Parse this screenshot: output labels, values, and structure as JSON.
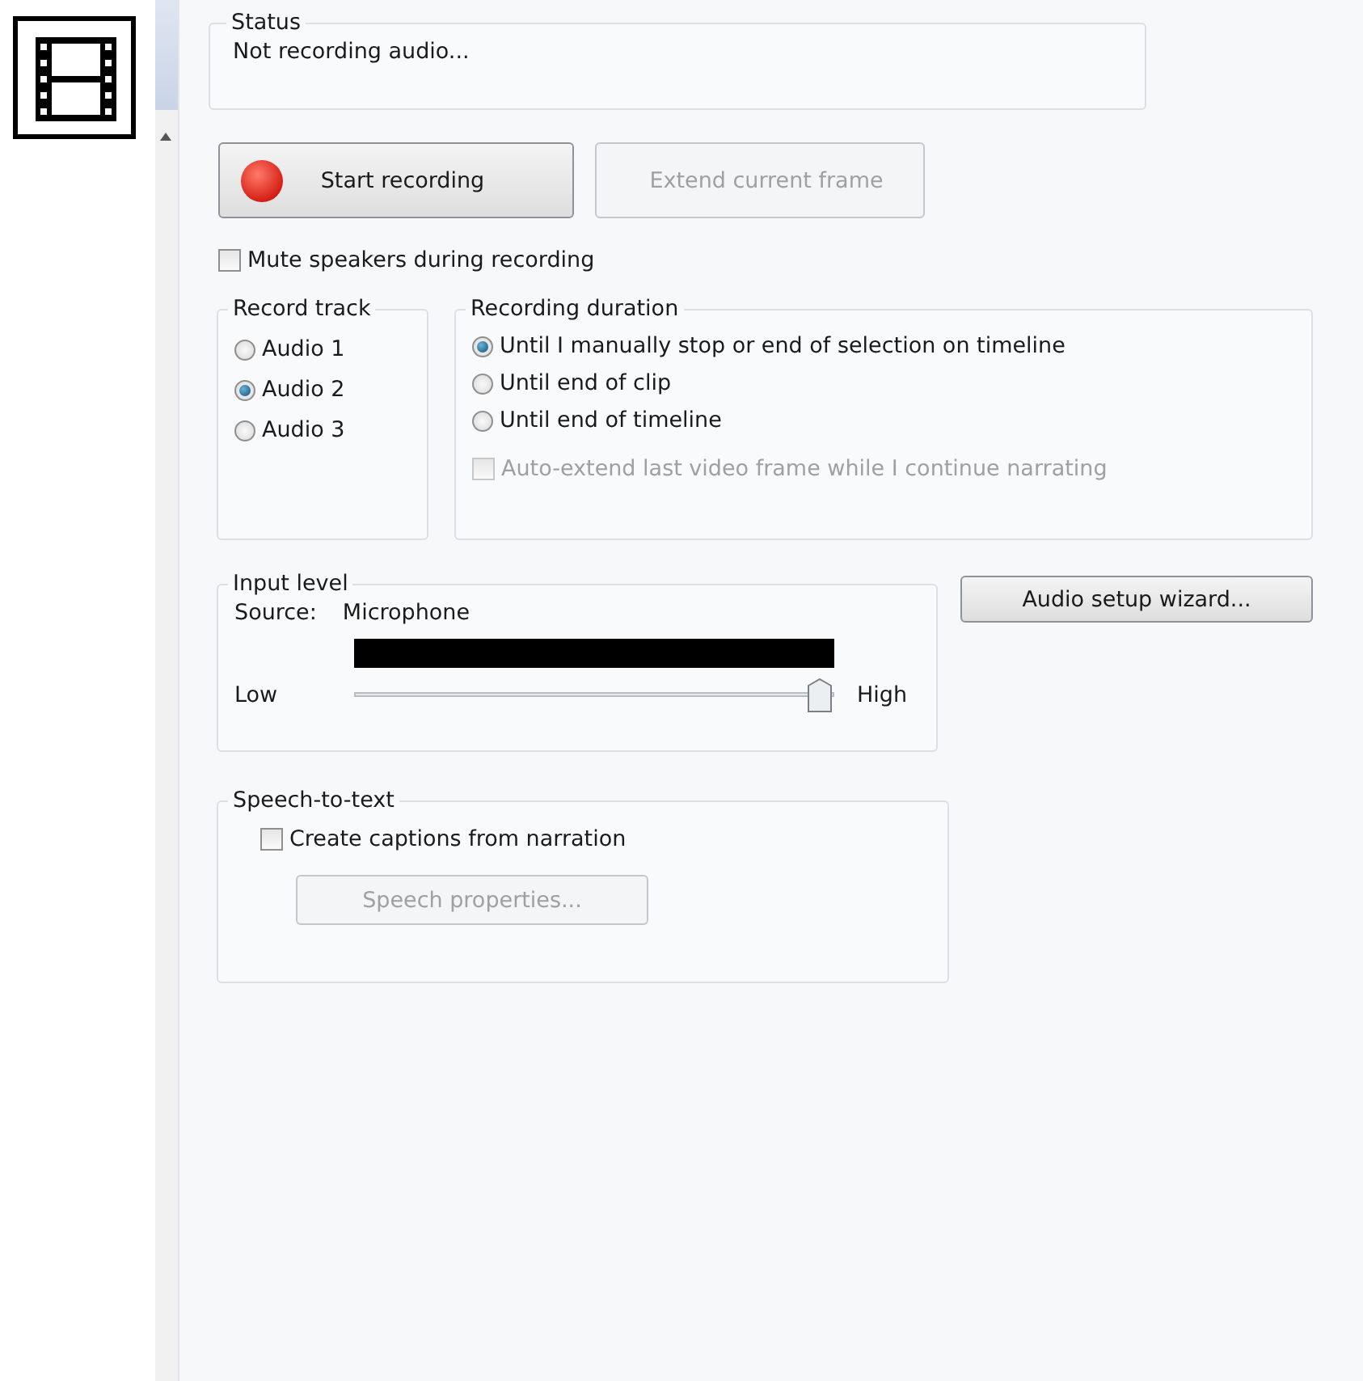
{
  "status": {
    "title": "Status",
    "text": "Not recording audio..."
  },
  "buttons": [
    {
      "label": "Start recording",
      "kind": "record",
      "disabled": false
    },
    {
      "label": "Extend current frame",
      "kind": "plain",
      "disabled": true
    }
  ],
  "mute": {
    "label": "Mute speakers during recording",
    "checked": false
  },
  "record_track": {
    "title": "Record track",
    "options": [
      {
        "label": "Audio 1",
        "selected": false
      },
      {
        "label": "Audio 2",
        "selected": true
      },
      {
        "label": "Audio 3",
        "selected": false
      }
    ]
  },
  "recording_duration": {
    "title": "Recording duration",
    "options": [
      {
        "label": "Until I manually stop or end of selection on timeline",
        "selected": true
      },
      {
        "label": "Until end of clip",
        "selected": false
      },
      {
        "label": "Until end of timeline",
        "selected": false
      }
    ],
    "auto_extend": {
      "label": "Auto-extend last video frame while I continue narrating",
      "checked": false,
      "disabled": true
    }
  },
  "input_level": {
    "title": "Input level",
    "source_label": "Source:",
    "source": "Microphone",
    "low": "Low",
    "high": "High",
    "level": 0.97
  },
  "audio_setup_button": "Audio setup wizard...",
  "speech": {
    "title": "Speech-to-text",
    "captions": {
      "label": "Create captions from narration",
      "checked": false
    },
    "properties_button": {
      "label": "Speech properties...",
      "disabled": true
    }
  }
}
